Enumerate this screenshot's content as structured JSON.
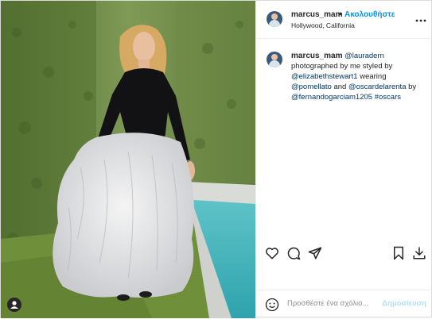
{
  "header": {
    "username": "marcus_mam",
    "separator": "•",
    "follow_label": "Ακολουθήστε",
    "location": "Hollywood, California"
  },
  "caption": {
    "username": "marcus_mam",
    "mention1": "@lauradern",
    "text1": "photographed by me styled by",
    "mention2": "@elizabethstewart1",
    "text2": "wearing",
    "mention3": "@pomellato",
    "text3": "and",
    "mention4": "@oscardelarenta",
    "text4": "by",
    "mention5": "@fernandogarciam1205",
    "hashtag": "#oscars"
  },
  "footer": {
    "comment_placeholder": "Προσθέστε ένα σχόλιο...",
    "post_label": "Δημοσίευση"
  },
  "icons": [
    "more-icon",
    "heart-icon",
    "comment-icon",
    "share-icon",
    "bookmark-icon",
    "download-icon",
    "emoji-icon",
    "tagged-user-icon"
  ],
  "colors": {
    "accent": "#0095f6",
    "link": "#00376b",
    "post_disabled": "#b2dffc"
  }
}
